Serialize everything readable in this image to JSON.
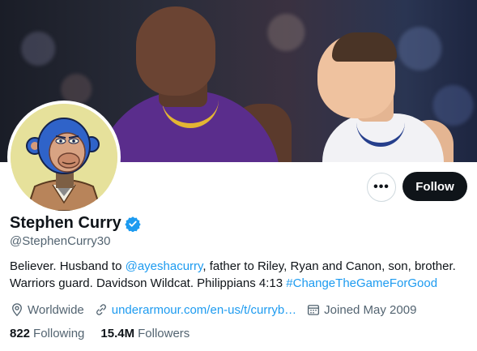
{
  "profile": {
    "name": "Stephen Curry",
    "handle": "@StephenCurry30",
    "bio": {
      "part1": "Believer. Husband to ",
      "mention": "@ayeshacurry",
      "part2": ", father to Riley, Ryan and Canon, son, brother. Warriors guard. Davidson Wildcat. Philippians 4:13 ",
      "hashtag": "#ChangeTheGameForGood"
    },
    "location": "Worldwide",
    "website": "underarmour.com/en-us/t/curryb…",
    "joined": "Joined May 2009",
    "following_count": "822",
    "following_label": "Following",
    "followers_count": "15.4M",
    "followers_label": "Followers"
  },
  "actions": {
    "more_label": "•••",
    "follow_label": "Follow"
  },
  "icons": {
    "location": "location-pin-icon",
    "link": "link-icon",
    "calendar": "calendar-icon",
    "verified": "verified-badge-icon"
  },
  "colors": {
    "accent": "#1d9bf0",
    "primary_text": "#0f1419",
    "secondary_text": "#536471",
    "follow_button": "#0f1419"
  }
}
